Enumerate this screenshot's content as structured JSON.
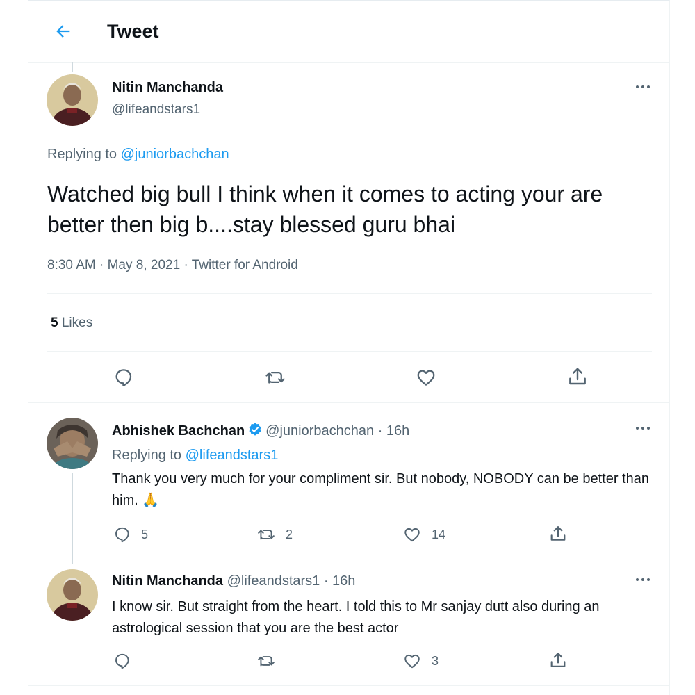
{
  "header": {
    "title": "Tweet"
  },
  "main_tweet": {
    "author_name": "Nitin Manchanda",
    "author_handle": "@lifeandstars1",
    "replying_label": "Replying to",
    "replying_handle": "@juniorbachchan",
    "text": "Watched big bull I think when it comes to acting your are better then big b....stay blessed guru bhai",
    "meta": "8:30 AM · May 8, 2021 · Twitter for Android",
    "likes_count": "5",
    "likes_label": "Likes",
    "actions": [
      "reply-icon",
      "retweet-icon",
      "like-icon",
      "share-icon"
    ]
  },
  "replies": [
    {
      "author_name": "Abhishek Bachchan",
      "verified": true,
      "author_handle": "@juniorbachchan",
      "time": "· 16h",
      "replying_label": "Replying to",
      "replying_handle": "@lifeandstars1",
      "text": "Thank you very much for your compliment sir. But nobody, NOBODY can be better than him. 🙏",
      "reply_count": "5",
      "retweet_count": "2",
      "like_count": "14"
    },
    {
      "author_name": "Nitin Manchanda",
      "author_handle": "@lifeandstars1",
      "time": "· 16h",
      "text": "I know sir. But straight from the heart. I told this to Mr sanjay dutt also during an astrological session that you are the best actor",
      "reply_count": "",
      "retweet_count": "",
      "like_count": "3"
    }
  ],
  "colors": {
    "accent": "#1d9bf0",
    "muted": "#536471",
    "text": "#0f1419",
    "verified": "#1d9bf0"
  }
}
